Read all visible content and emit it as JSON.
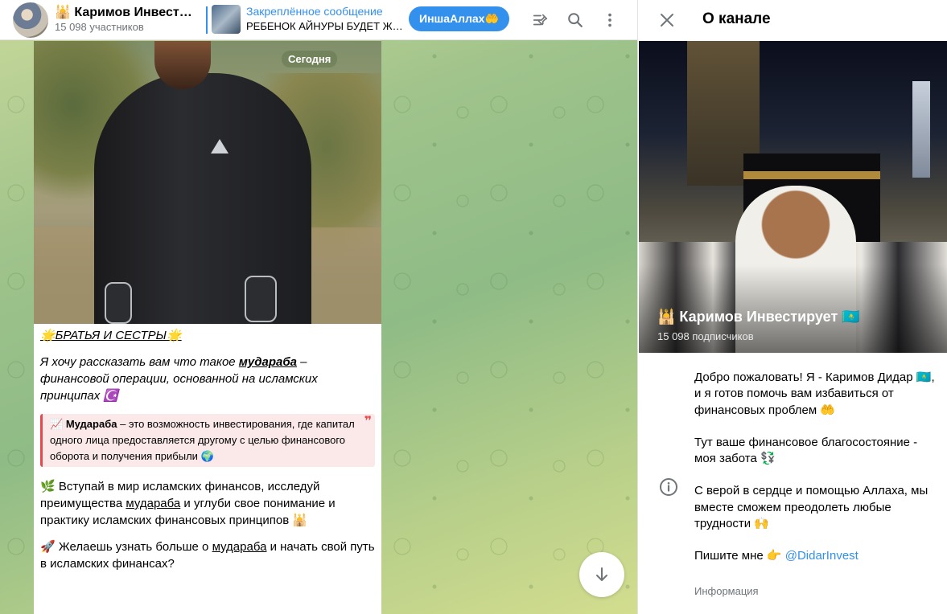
{
  "header": {
    "channel_title": "🕌 Каримов Инвест…",
    "members": "15 098 участников",
    "pinned_label": "Закреплённое сообщение",
    "pinned_text": "РЕБЕНОК АЙНУРЫ БУДЕТ Ж…",
    "pinned_button": "ИншаАллах🤲",
    "icons": [
      "pinned-list-icon",
      "search-icon",
      "more-vertical-icon"
    ]
  },
  "message": {
    "date_badge": "Сегодня",
    "heading": "🌟БРАТЬЯ И СЕСТРЫ🌟",
    "intro_1": "Я хочу рассказать вам что такое ",
    "intro_link": "мудараба",
    "intro_2": " – финансовой операции, основанной на исламских принципах ☪️",
    "quote_prefix": "📈 ",
    "quote_term": "Мудараба",
    "quote_text": " – это возможность инвестирования, где капитал одного лица предоставляется другому с целью финансового оборота и получения прибыли 🌍",
    "quote_mark": "❞",
    "p2_1": "🌿 Вступай в мир исламских финансов, исследуй преимущества ",
    "p2_link": "мудараба",
    "p2_2": " и углуби свое понимание и практику исламских финансовых принципов 🕌",
    "p3_1": "🚀 Желаешь узнать больше о ",
    "p3_link": "мудараба",
    "p3_2": " и начать свой путь в исламских финансах?"
  },
  "panel": {
    "title": "О канале",
    "channel_name": "🕌 Каримов Инвестирует 🇰🇿",
    "subscribers": "15 098 подписчиков",
    "about_1": "Добро пожаловать! Я - Каримов Дидар 🇰🇿, и я готов помочь вам избавиться от финансовых проблем 🤲",
    "about_2": "Тут ваше финансовое благосостояние - моя забота 💱",
    "about_3": "С верой в сердце и помощью Аллаха, мы вместе сможем преодолеть любые трудности 🙌",
    "about_4_prefix": "Пишите мне 👉 ",
    "about_4_link": "@DidarInvest",
    "about_label": "Информация"
  },
  "colors": {
    "accent": "#3390ec",
    "quote_border": "#e5484d",
    "secondary_text": "#707579"
  }
}
